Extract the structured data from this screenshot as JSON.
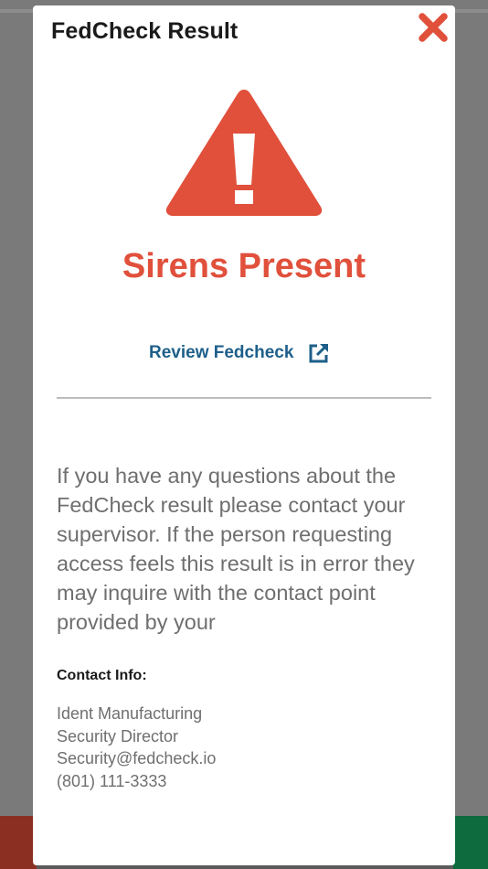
{
  "modal": {
    "title": "FedCheck Result",
    "result": "Sirens Present",
    "review_link_label": "Review Fedcheck",
    "message": "If you have any questions about the FedCheck result please contact your supervisor. If the person requesting access feels this result is in error they may inquire with the contact point provided by your",
    "contact_heading": "Contact Info:",
    "contact": {
      "company": "Ident Manufacturing",
      "role": "Security Director",
      "email": "Security@fedcheck.io",
      "phone": "(801) 111-3333"
    }
  },
  "icons": {
    "close": "close-x-icon",
    "warning": "warning-triangle-icon",
    "external_link": "external-link-icon"
  },
  "colors": {
    "alert_red": "#e0503b",
    "link_blue": "#1d5f8a",
    "text_gray": "#6f6f6f",
    "title_dark": "#1a1a1a"
  }
}
